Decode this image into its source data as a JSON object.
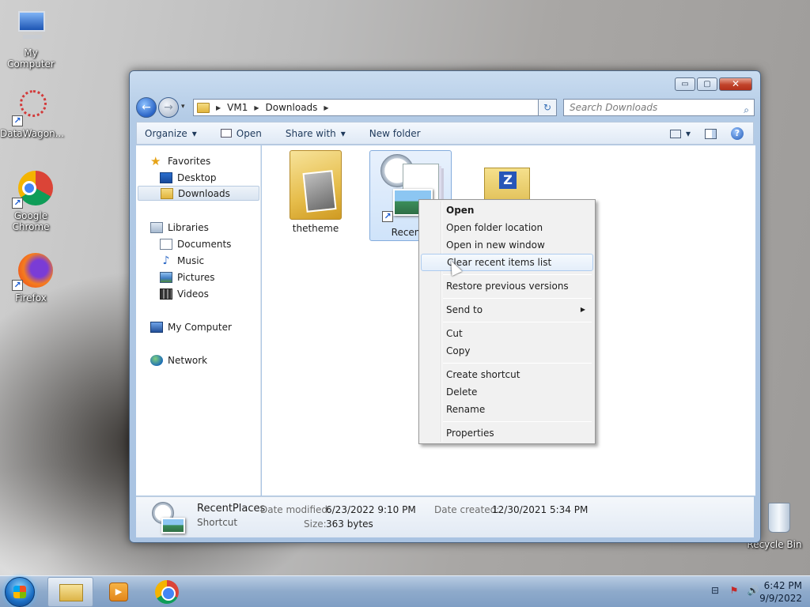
{
  "desktop": {
    "icons": [
      {
        "label": "My Computer"
      },
      {
        "label": "DataWagon..."
      },
      {
        "label": "Google Chrome"
      },
      {
        "label": "Firefox"
      },
      {
        "label": "Recycle Bin"
      }
    ]
  },
  "window": {
    "controls": {
      "minimize": "▭",
      "maximize": "▢",
      "close": "✕"
    },
    "address": {
      "crumbs": [
        "VM1",
        "Downloads"
      ],
      "search_placeholder": "Search Downloads"
    },
    "toolbar": {
      "organize": "Organize",
      "open": "Open",
      "share_with": "Share with",
      "new_folder": "New folder",
      "dropdown_glyph": "▾"
    },
    "nav": {
      "favorites": "Favorites",
      "desktop": "Desktop",
      "downloads": "Downloads",
      "libraries": "Libraries",
      "documents": "Documents",
      "music": "Music",
      "pictures": "Pictures",
      "videos": "Videos",
      "my_computer": "My Computer",
      "network": "Network"
    },
    "files": [
      {
        "name": "thetheme"
      },
      {
        "name": "RecentP"
      },
      {
        "name": ""
      }
    ],
    "details": {
      "name": "RecentPlaces",
      "type": "Shortcut",
      "date_modified_label": "Date modified:",
      "date_modified": "6/23/2022 9:10 PM",
      "date_created_label": "Date created:",
      "date_created": "12/30/2021 5:34 PM",
      "size_label": "Size:",
      "size": "363 bytes"
    }
  },
  "context_menu": {
    "items": [
      "Open",
      "Open folder location",
      "Open in new window",
      "Clear recent items list",
      "Restore previous versions",
      "Send to",
      "Cut",
      "Copy",
      "Create shortcut",
      "Delete",
      "Rename",
      "Properties"
    ],
    "submenu_glyph": "▶"
  },
  "taskbar": {
    "time": "6:42 PM",
    "date": "9/9/2022"
  },
  "icons": {
    "shortcut_arrow": "↗",
    "search": "⌕",
    "refresh": "↻",
    "back": "←",
    "forward": "→",
    "star": "★",
    "music": "♪",
    "help": "?",
    "speaker": "🔊",
    "flag_tray": "⚑",
    "network_tray": "⊟",
    "media_play": "▶",
    "zip_letter": "Z"
  }
}
